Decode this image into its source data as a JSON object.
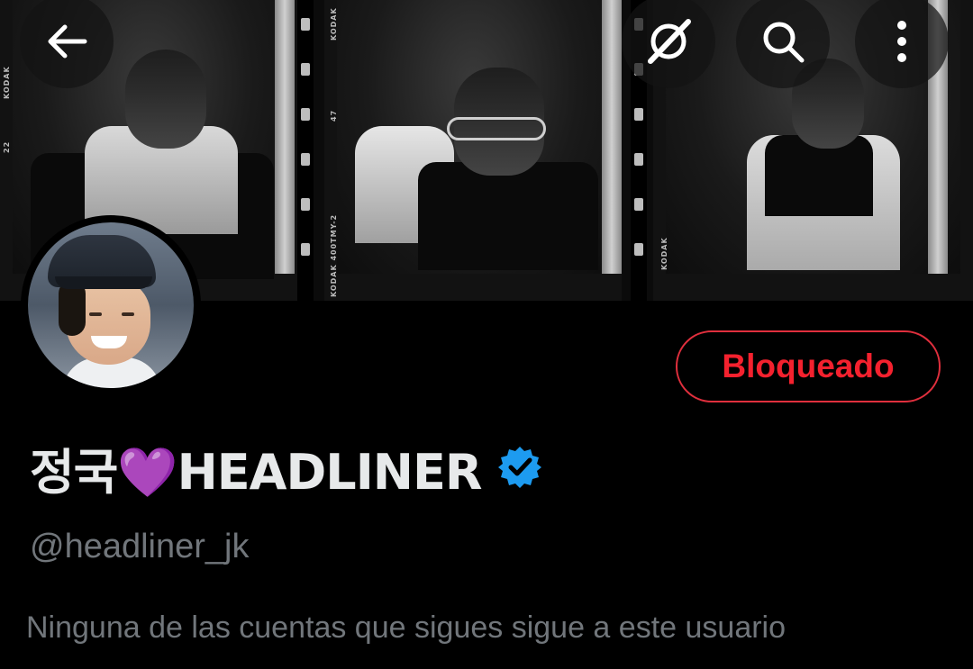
{
  "header": {
    "back_icon": "arrow-left-icon",
    "hide_icon": "eye-slash-icon",
    "search_icon": "search-icon",
    "more_icon": "more-vertical-icon"
  },
  "banner": {
    "film_labels": [
      "KODAK",
      "KODAK",
      "KODAK",
      "KODAK 400TMY-2",
      "47",
      "22"
    ]
  },
  "profile": {
    "display_name": "정국💜HEADLINER",
    "handle": "@headliner_jk",
    "verified": true,
    "verified_color": "#1d9bf0",
    "followers_note": "Ninguna de las cuentas que sigues sigue a este usuario"
  },
  "actions": {
    "blocked_label": "Bloqueado",
    "blocked_color": "#f4212e"
  }
}
